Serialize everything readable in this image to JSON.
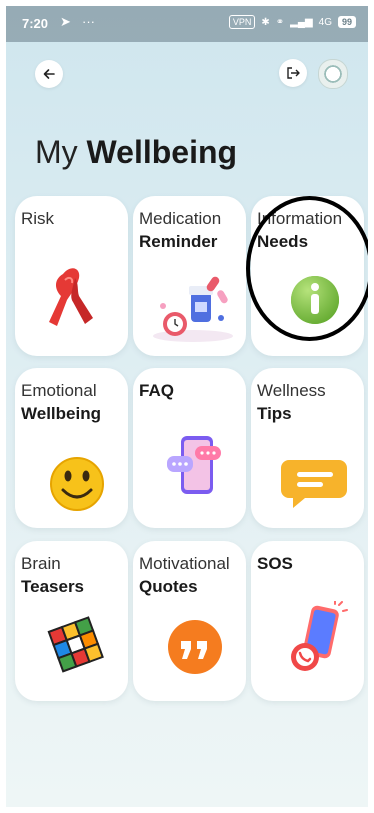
{
  "status_bar": {
    "time": "7:20",
    "vpn": "VPN",
    "network": "4G",
    "battery": "99"
  },
  "header": {
    "back_icon": "arrow-left-icon",
    "logout_icon": "logout-icon",
    "avatar": "profile-avatar"
  },
  "page": {
    "title_regular": "My",
    "title_bold": "Wellbeing"
  },
  "tiles": [
    {
      "line1": "Risk",
      "line2": "",
      "icon": "awareness-ribbon-icon"
    },
    {
      "line1": "Medication",
      "line2": "Reminder",
      "icon": "pills-and-clock-icon"
    },
    {
      "line1": "Information",
      "line2": "Needs",
      "icon": "info-icon"
    },
    {
      "line1": "Emotional",
      "line2": "Wellbeing",
      "icon": "smiley-icon"
    },
    {
      "line1": "",
      "line2": "FAQ",
      "icon": "phone-chat-icon"
    },
    {
      "line1": "Wellness",
      "line2": "Tips",
      "icon": "message-bubble-icon"
    },
    {
      "line1": "Brain",
      "line2": "Teasers",
      "icon": "rubiks-cube-icon"
    },
    {
      "line1": "Motivational",
      "line2": "Quotes",
      "icon": "quote-icon"
    },
    {
      "line1": "",
      "line2": "SOS",
      "icon": "sos-phone-icon"
    }
  ],
  "colors": {
    "background_top": "#cfe6ee",
    "background_bottom": "#eef6f6",
    "card": "#ffffff",
    "ribbon": "#e53935",
    "info_green": "#7cc242",
    "smiley_yellow": "#f7c21a",
    "quote_orange": "#f57c1f",
    "highlight_ring": "#000000"
  }
}
